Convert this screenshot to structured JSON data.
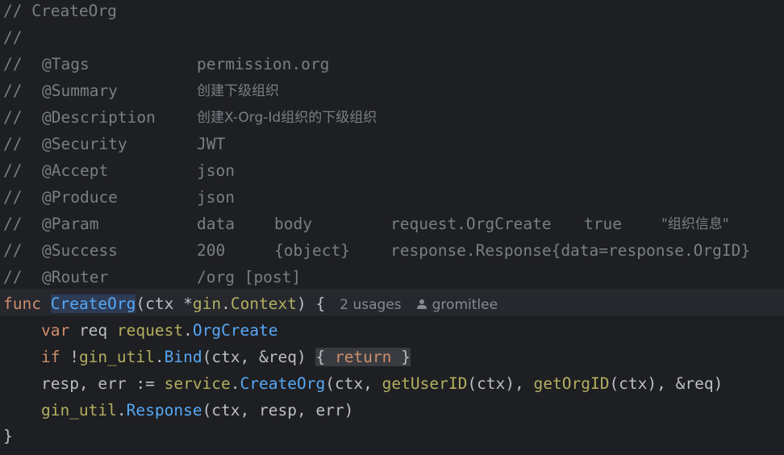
{
  "comments": {
    "title": "// CreateOrg",
    "blank": "//",
    "prefix": "//",
    "rows": [
      {
        "tag": "@Tags",
        "cols": [
          "permission.org"
        ]
      },
      {
        "tag": "@Summary",
        "cols": [
          "创建下级组织"
        ]
      },
      {
        "tag": "@Description",
        "cols": [
          "创建X-Org-Id组织的下级组织"
        ]
      },
      {
        "tag": "@Security",
        "cols": [
          "JWT"
        ]
      },
      {
        "tag": "@Accept",
        "cols": [
          "json"
        ]
      },
      {
        "tag": "@Produce",
        "cols": [
          "json"
        ]
      },
      {
        "tag": "@Param",
        "cols": [
          "data",
          "body",
          "request.OrgCreate",
          "true",
          "\"组织信息\""
        ]
      },
      {
        "tag": "@Success",
        "cols": [
          "200",
          "{object}",
          "response.Response{data=response.OrgID}"
        ]
      },
      {
        "tag": "@Router",
        "cols": [
          "/org [post]"
        ]
      }
    ]
  },
  "code": {
    "func_kw": "func",
    "func_name": "CreateOrg",
    "sig_open": "(ctx *",
    "sig_pkg": "gin",
    "sig_dot": ".",
    "sig_type": "Context",
    "sig_close": ") {",
    "usages": "2 usages",
    "author": "gromitlee",
    "l2_var": "var",
    "l2_req": " req ",
    "l2_pkg": "request",
    "l2_dot": ".",
    "l2_type": "OrgCreate",
    "l3_if": "if",
    "l3_not": " !",
    "l3_pkg": "gin_util",
    "l3_dot": ".",
    "l3_fn": "Bind",
    "l3_args": "(ctx, &req) ",
    "l3_fold_open": "{ ",
    "l3_return": "return",
    "l3_fold_close": " }",
    "l4_vars": "resp, err := ",
    "l4_pkg": "service",
    "l4_dot": ".",
    "l4_fn": "CreateOrg",
    "l4_a1": "(ctx, ",
    "l4_fn2": "getUserID",
    "l4_a2": "(ctx), ",
    "l4_fn3": "getOrgID",
    "l4_a3": "(ctx), &req)",
    "l5_pkg": "gin_util",
    "l5_dot": ".",
    "l5_fn": "Response",
    "l5_args": "(ctx, resp, err)",
    "closing": "}"
  }
}
